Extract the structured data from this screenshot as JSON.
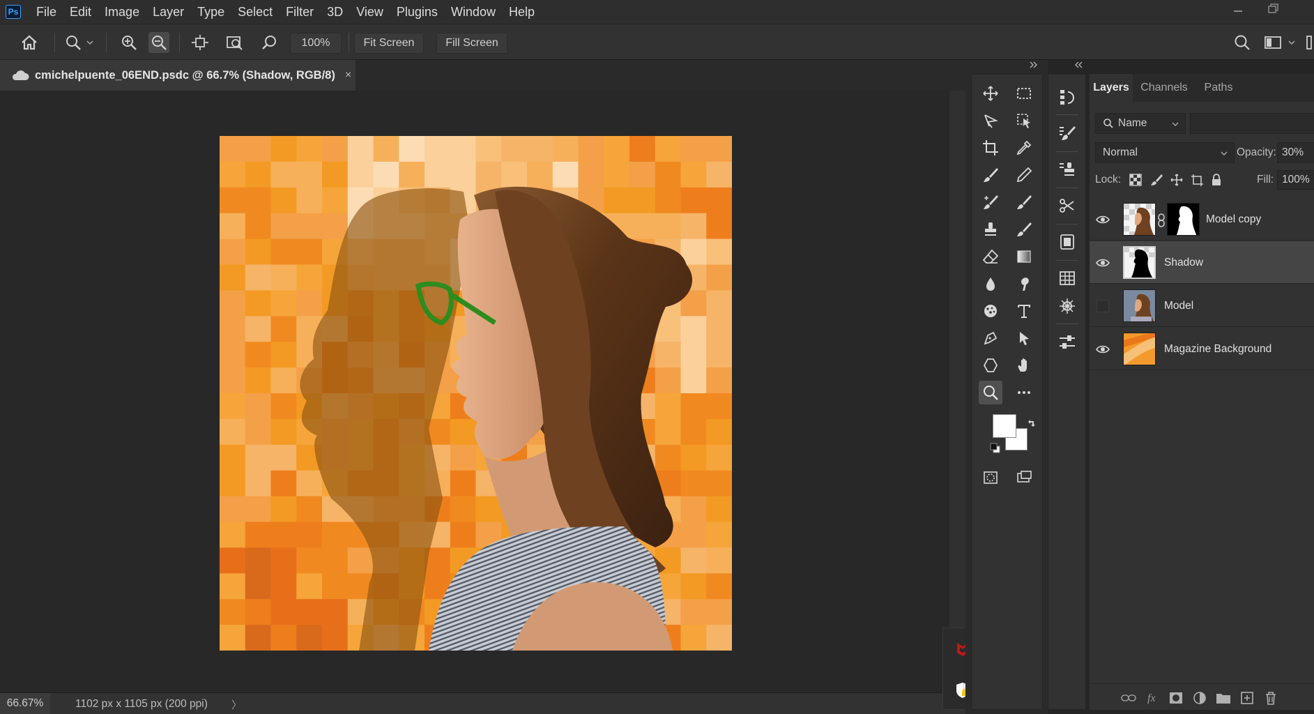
{
  "app": {
    "logo": "Ps"
  },
  "menu": [
    "File",
    "Edit",
    "Image",
    "Layer",
    "Type",
    "Select",
    "Filter",
    "3D",
    "View",
    "Plugins",
    "Window",
    "Help"
  ],
  "options": {
    "zoom_value": "100%",
    "fit_screen": "Fit Screen",
    "fill_screen": "Fill Screen"
  },
  "document": {
    "tab_title": "cmichelpuente_06END.psdc @ 66.7% (Shadow, RGB/8)",
    "close_glyph": "×"
  },
  "status": {
    "zoom": "66.67%",
    "doc_info": "1102 px x 1105 px (200 ppi)",
    "arrow": "〉"
  },
  "layers_panel": {
    "tabs": [
      "Layers",
      "Channels",
      "Paths"
    ],
    "filter_kind": "Name",
    "blend_mode": "Normal",
    "opacity_label": "Opacity:",
    "opacity": "30%",
    "lock_label": "Lock:",
    "fill_label": "Fill:",
    "fill": "100%",
    "layers": [
      {
        "name": "Model copy",
        "visible": true,
        "has_mask": true,
        "thumb": "model"
      },
      {
        "name": "Shadow",
        "visible": true,
        "has_mask": false,
        "thumb": "shadow",
        "selected": true
      },
      {
        "name": "Model",
        "visible": false,
        "has_mask": false,
        "thumb": "model"
      },
      {
        "name": "Magazine Background",
        "visible": true,
        "has_mask": false,
        "thumb": "background"
      }
    ]
  },
  "colors": {
    "accent": "#31a8ff",
    "foreground": "#ffffff",
    "background": "#ffffff",
    "canvas_orange": "#f38a1f"
  },
  "tools_icons": [
    "move-icon",
    "marquee-icon",
    "lasso-icon",
    "object-select-icon",
    "crop-icon",
    "eyedropper-icon",
    "brush-icon",
    "pencil-icon",
    "healing-icon",
    "mixer-brush-icon",
    "stamp-icon",
    "history-brush-icon",
    "eraser-icon",
    "gradient-icon",
    "blur-icon",
    "smudge-icon",
    "sponge-icon",
    "type-icon",
    "pen-icon",
    "direct-select-icon",
    "shape-icon",
    "hand-icon",
    "zoom-icon",
    "more-icon"
  ]
}
